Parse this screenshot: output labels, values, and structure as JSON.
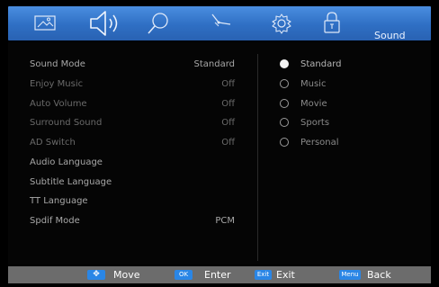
{
  "topbar": {
    "icons": [
      "picture-icon",
      "speaker-icon",
      "search-icon",
      "satellite-icon",
      "gear-icon",
      "lock-icon"
    ],
    "title": "Sound",
    "accent": "#3a7fd6"
  },
  "settings": [
    {
      "label": "Sound Mode",
      "value": "Standard"
    },
    {
      "label": "Enjoy Music",
      "value": "Off"
    },
    {
      "label": "Auto Volume",
      "value": "Off"
    },
    {
      "label": "Surround Sound",
      "value": "Off"
    },
    {
      "label": "AD Switch",
      "value": "Off"
    },
    {
      "label": "Audio Language",
      "value": ""
    },
    {
      "label": "Subtitle Language",
      "value": ""
    },
    {
      "label": "TT Language",
      "value": ""
    },
    {
      "label": "Spdif Mode",
      "value": "PCM"
    }
  ],
  "options": [
    {
      "label": "Standard",
      "selected": true
    },
    {
      "label": "Music",
      "selected": false
    },
    {
      "label": "Movie",
      "selected": false
    },
    {
      "label": "Sports",
      "selected": false
    },
    {
      "label": "Personal",
      "selected": false
    }
  ],
  "footer": {
    "move": {
      "key": "✥",
      "label": "Move"
    },
    "enter": {
      "key": "OK",
      "label": "Enter"
    },
    "exit": {
      "key": "Exit",
      "label": "Exit"
    },
    "back": {
      "key": "Menu",
      "label": "Back"
    }
  }
}
